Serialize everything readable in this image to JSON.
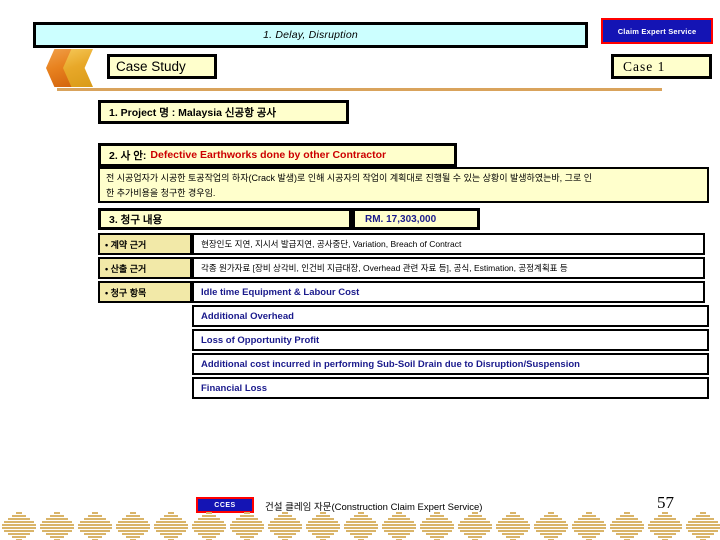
{
  "slide": {
    "banner_title": "1. Delay, Disruption",
    "badge_top": "Claim Expert Service",
    "section_title": "Case Study",
    "case_number": "Case  1",
    "project": {
      "label": "1. Project 명  : Malaysia 신공항 공사"
    },
    "issue": {
      "label": "2. 사 안:",
      "value": "Defective Earthworks done by other Contractor"
    },
    "description": {
      "line1": "전 시공업자가 시공한 토공작업의 하자(Crack 발생)로 인해 시공자의 작업이 계획대로 진행될 수 있는 상황이 발생하였는바, 그로 인",
      "line2": "한  추가비용을 청구한 경우임."
    },
    "claim": {
      "header": "3. 청구 내용",
      "amount": "RM. 17,303,000",
      "rows": [
        {
          "label": "• 계약 근거",
          "value": "현장인도 지연, 지시서 발급지연, 공사중단, Variation, Breach of Contract"
        },
        {
          "label": "• 산출 근거",
          "value": "각종 원가자료 [장비 상각비, 인건비 지급대장, Overhead 관련 자료 등], 공식, Estimation, 공정계획표 등"
        },
        {
          "label": "• 청구 항목",
          "value": "Idle time Equipment & Labour Cost"
        }
      ],
      "items": [
        "Additional Overhead",
        "Loss of Opportunity Profit",
        "Additional cost incurred in performing Sub-Soil Drain due to Disruption/Suspension",
        "Financial Loss"
      ]
    },
    "footer": {
      "badge": "CCES",
      "text": "건설 클레임 자문(Construction Claim Expert Service)",
      "page": "57"
    },
    "colors": {
      "banner_bg": "#ccffff",
      "box_bg": "#ffffcc",
      "label_bg": "#f2e9a8",
      "badge_blue": "#1414b4",
      "badge_red": "#ff0000",
      "issue_red": "#cc0000",
      "navy": "#1a1a8c",
      "gold": "#d9a35c"
    }
  }
}
